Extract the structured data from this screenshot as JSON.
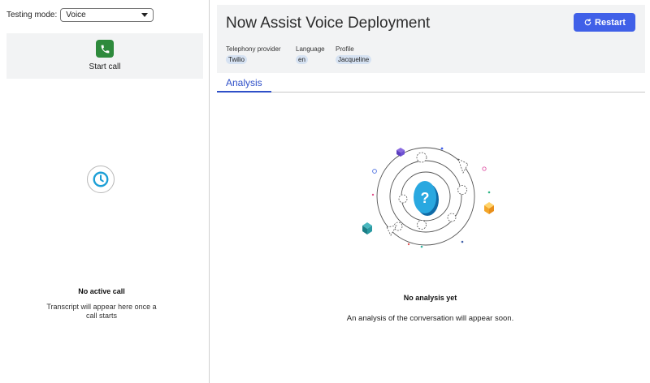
{
  "left_panel": {
    "testing_mode_label": "Testing mode:",
    "testing_mode_value": "Voice",
    "start_call_label": "Start call",
    "no_active_call": "No active call",
    "transcript_hint": "Transcript will appear here once a call starts"
  },
  "header": {
    "title": "Now Assist Voice Deployment",
    "restart_label": "Restart",
    "fields": [
      {
        "label": "Telephony provider",
        "value": "Twilio"
      },
      {
        "label": "Language",
        "value": "en"
      },
      {
        "label": "Profile",
        "value": "Jacqueline"
      }
    ]
  },
  "tabs": [
    {
      "label": "Analysis",
      "active": true
    }
  ],
  "empty_state": {
    "title": "No analysis yet",
    "message": "An analysis of the conversation will appear soon."
  },
  "colors": {
    "accent": "#4060e8",
    "call_button": "#2e8a3c",
    "panel_bg": "#f2f3f4",
    "chip_bg": "#d6e2f2"
  },
  "icons": {
    "call_button": "phone-icon",
    "restart": "refresh-icon",
    "waiting": "clock-icon",
    "empty_state": "question-orbit-illustration"
  }
}
